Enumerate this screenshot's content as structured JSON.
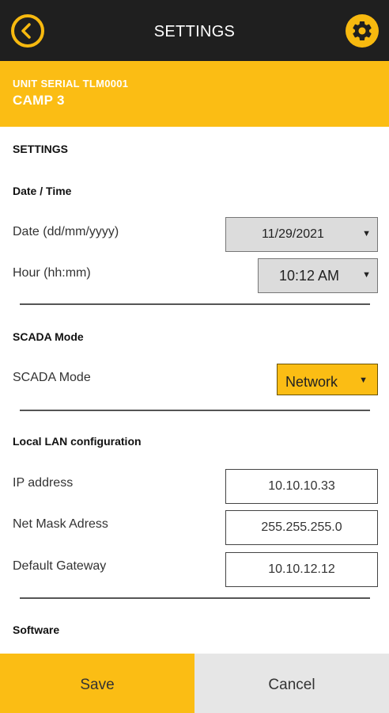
{
  "header": {
    "title": "SETTINGS",
    "back_icon": "chevron-left-circle-icon",
    "settings_icon": "gear-icon",
    "accent_color": "#fbbd14"
  },
  "unit": {
    "serial": "UNIT SERIAL TLM0001",
    "name": "CAMP 3"
  },
  "settings_heading": "SETTINGS",
  "date_time": {
    "section": "Date / Time",
    "date_label": "Date (dd/mm/yyyy)",
    "date_value": "11/29/2021",
    "hour_label": "Hour (hh:mm)",
    "hour_value": "10:12 AM"
  },
  "scada": {
    "section": "SCADA Mode",
    "label": "SCADA Mode",
    "value": "Network"
  },
  "lan": {
    "section": "Local LAN configuration",
    "ip_label": "IP address",
    "ip_value": "10.10.10.33",
    "mask_label": "Net Mask Adress",
    "mask_value": "255.255.255.0",
    "gateway_label": "Default Gateway",
    "gateway_value": "10.10.12.12"
  },
  "software": {
    "section": "Software"
  },
  "actions": {
    "save_label": "Save",
    "cancel_label": "Cancel"
  }
}
